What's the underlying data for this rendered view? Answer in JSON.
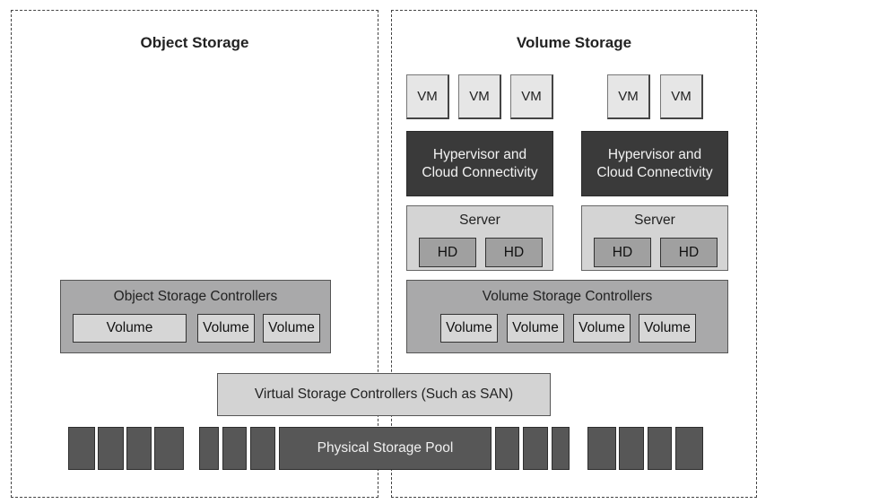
{
  "panels": {
    "object_storage": {
      "title": "Object Storage"
    },
    "volume_storage": {
      "title": "Volume Storage"
    }
  },
  "vm_label": "VM",
  "vm_groups": [
    {
      "count": 3
    },
    {
      "count": 2
    }
  ],
  "hypervisor": {
    "line1": "Hypervisor and",
    "line2": "Cloud Connectivity"
  },
  "server": {
    "label": "Server",
    "disk_label": "HD"
  },
  "object_controllers": {
    "label": "Object Storage Controllers",
    "volumes": [
      "Volume",
      "Volume",
      "Volume"
    ]
  },
  "volume_controllers": {
    "label": "Volume Storage Controllers",
    "volumes": [
      "Volume",
      "Volume",
      "Volume",
      "Volume"
    ]
  },
  "virtual_controllers": {
    "label": "Virtual Storage Controllers (Such as SAN)"
  },
  "physical_pool": {
    "label": "Physical Storage Pool",
    "disk_blocks_count": 14
  },
  "colors": {
    "dark_fill": "#3a3a3a",
    "block_fill": "#575757",
    "controller_fill": "#a9a9aa",
    "light_fill": "#d4d4d4",
    "vm_fill": "#e6e6e6"
  }
}
